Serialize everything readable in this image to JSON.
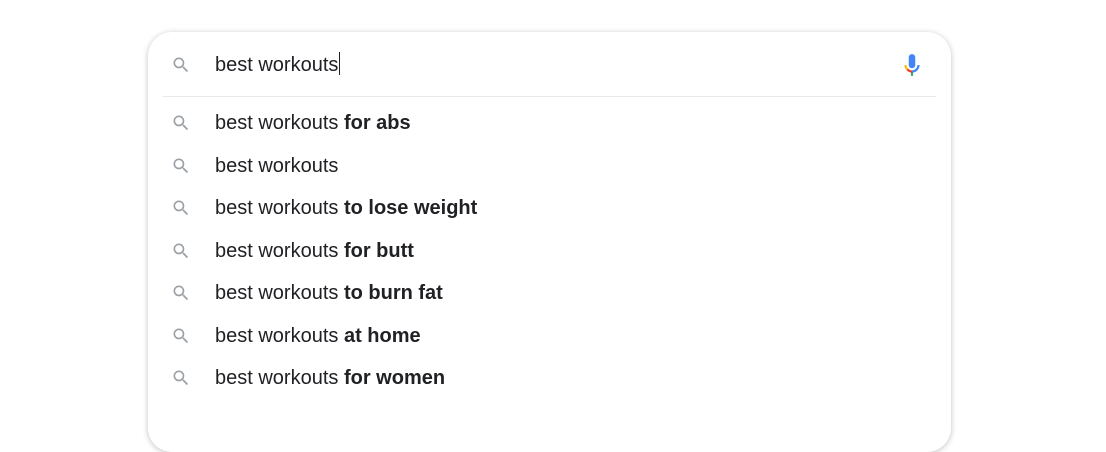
{
  "search": {
    "query": "best workouts",
    "icon": "search-icon",
    "voice_icon": "microphone-icon"
  },
  "suggestions": [
    {
      "prefix": "best workouts",
      "completion": " for abs"
    },
    {
      "prefix": "best workouts",
      "completion": ""
    },
    {
      "prefix": "best workouts",
      "completion": " to lose weight"
    },
    {
      "prefix": "best workouts",
      "completion": " for butt"
    },
    {
      "prefix": "best workouts",
      "completion": " to burn fat"
    },
    {
      "prefix": "best workouts",
      "completion": " at home"
    },
    {
      "prefix": "best workouts",
      "completion": " for women"
    }
  ],
  "colors": {
    "text": "#202124",
    "icon": "#9aa0a6",
    "mic_blue": "#4285f4",
    "mic_red": "#ea4335",
    "mic_yellow": "#fbbc04",
    "mic_green": "#34a853"
  }
}
